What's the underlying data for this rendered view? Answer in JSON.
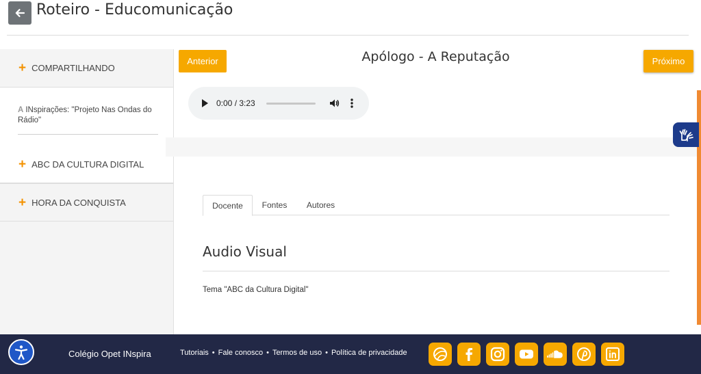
{
  "header": {
    "title": "Roteiro - Educomunicação",
    "back_icon": "arrow-left-icon"
  },
  "sidebar": {
    "items": [
      {
        "label": "COMPARTILHANDO"
      },
      {
        "label": "ABC DA CULTURA DIGITAL"
      },
      {
        "label": "HORA DA CONQUISTA"
      }
    ],
    "subitem": {
      "glyph": "A",
      "label": "INspirações: \"Projeto Nas Ondas do Rádio\""
    }
  },
  "lesson": {
    "prev_label": "Anterior",
    "next_label": "Próximo",
    "title": "Apólogo - A Reputação"
  },
  "audio": {
    "time": "0:00 / 3:23",
    "progress": 0
  },
  "tabs": [
    {
      "label": "Docente",
      "active": true
    },
    {
      "label": "Fontes",
      "active": false
    },
    {
      "label": "Autores",
      "active": false
    }
  ],
  "content": {
    "heading": "Audio Visual",
    "text": "Tema \"ABC da Cultura Digital\""
  },
  "footer": {
    "brand": "Colégio Opet INspira",
    "links": [
      "Tutoriais",
      "Fale conosco",
      "Termos de uso",
      "Política de privacidade"
    ],
    "social_icons": [
      "opet-ball-icon",
      "facebook-icon",
      "instagram-icon",
      "youtube-icon",
      "soundcloud-icon",
      "pinterest-icon",
      "linkedin-icon"
    ]
  },
  "colors": {
    "accent_orange": "#f6a800",
    "footer_navy": "#222846",
    "libras_blue": "#1d3b8b",
    "accessibility_blue": "#1f57c7"
  }
}
